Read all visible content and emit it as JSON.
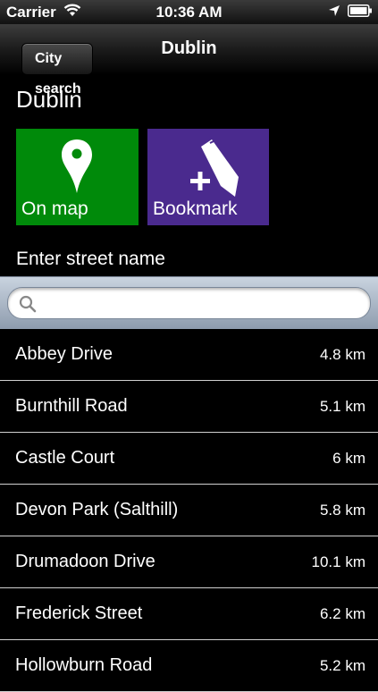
{
  "status": {
    "carrier": "Carrier",
    "time": "10:36 AM"
  },
  "nav": {
    "back_label": "City search",
    "title": "Dublin"
  },
  "city": {
    "name": "Dublin"
  },
  "tiles": {
    "map_label": "On map",
    "map_color": "#008a0a",
    "bookmark_label": "Bookmark",
    "bookmark_color": "#4a2a8e"
  },
  "street_prompt": "Enter street name",
  "search": {
    "value": "",
    "placeholder": ""
  },
  "streets": [
    {
      "name": "Abbey Drive",
      "distance": "4.8 km"
    },
    {
      "name": "Burnthill Road",
      "distance": "5.1 km"
    },
    {
      "name": "Castle Court",
      "distance": "6 km"
    },
    {
      "name": "Devon Park (Salthill)",
      "distance": "5.8 km"
    },
    {
      "name": "Drumadoon Drive",
      "distance": "10.1 km"
    },
    {
      "name": "Frederick Street",
      "distance": "6.2 km"
    },
    {
      "name": "Hollowburn Road",
      "distance": "5.2 km"
    }
  ]
}
